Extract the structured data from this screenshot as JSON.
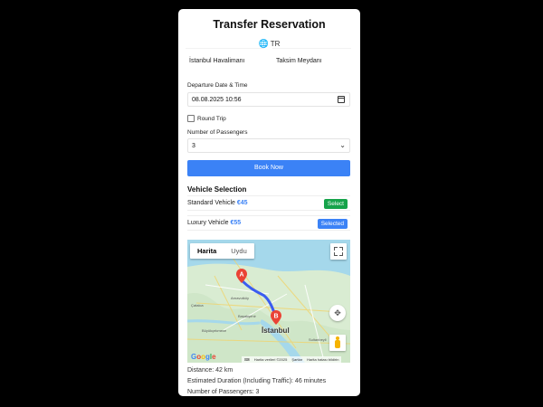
{
  "form": {
    "title": "Transfer Reservation",
    "language": "TR",
    "language_icon": "globe-icon",
    "pickup": "İstanbul Havalimanı",
    "dropoff": "Taksim Meydanı",
    "datetime_label": "Departure Date & Time",
    "datetime_value": "08.08.2025 10:56",
    "round_trip_label": "Round Trip",
    "round_trip_checked": false,
    "passengers_label": "Number of Passengers",
    "passengers_value": "3",
    "book_label": "Book Now"
  },
  "vehicles": {
    "section_title": "Vehicle Selection",
    "items": [
      {
        "name": "Standard Vehicle",
        "price": "€45",
        "button": "Select",
        "button_color": "#16a34a"
      },
      {
        "name": "Luxury Vehicle",
        "price": "€55",
        "button": "Selected",
        "button_color": "#3b82f6"
      }
    ]
  },
  "map": {
    "tabs": [
      "Harita",
      "Uydu"
    ],
    "active_tab": "Harita",
    "marker_a": "A",
    "marker_b": "B",
    "city": "İstanbul",
    "labels": [
      "Arnavutköy",
      "Çatalca",
      "Başakşehir",
      "Büyükçekmece",
      "Sultanbeyli"
    ],
    "attribution": "Google",
    "footer": [
      "Harita verileri ©2025",
      "Şartlar",
      "Harita hatası bildirin"
    ],
    "route_color": "#3b5cf0",
    "land_color": "#d9ecd2",
    "water_color": "#a5d8eb"
  },
  "summary": {
    "distance": "Distance: 42 km",
    "duration": "Estimated Duration (Including Traffic): 46 minutes",
    "passengers": "Number of Passengers: 3"
  },
  "colors": {
    "accent": "#3b82f6",
    "select_green": "#16a34a",
    "background": "#000000"
  }
}
